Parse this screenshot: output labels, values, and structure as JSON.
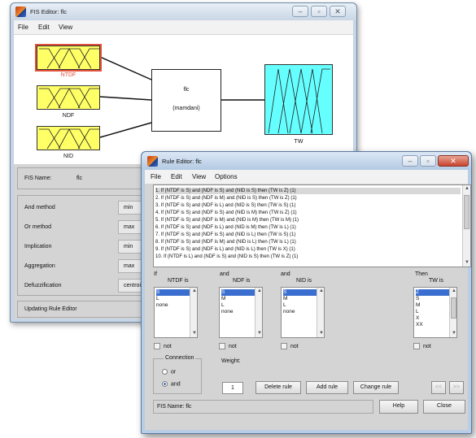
{
  "fis_editor": {
    "title": "FIS Editor: flc",
    "menu": [
      "File",
      "Edit",
      "View"
    ],
    "inputs": [
      "NTDF",
      "NDF",
      "NID"
    ],
    "system_name": "flc",
    "system_type": "(mamdani)",
    "output": "TW",
    "fis_name_label": "FIS Name:",
    "fis_name_value": "flc",
    "methods": [
      {
        "label": "And method",
        "value": "min"
      },
      {
        "label": "Or method",
        "value": "max"
      },
      {
        "label": "Implication",
        "value": "min"
      },
      {
        "label": "Aggregation",
        "value": "max"
      },
      {
        "label": "Defuzzification",
        "value": "centroid"
      }
    ],
    "status": "Updating Rule Editor",
    "colors": {
      "input_box": "#ffff66",
      "output_box": "#66ffff",
      "selected_outline": "#e0503a",
      "selected_label": "#e0503a"
    }
  },
  "rule_editor": {
    "title": "Rule Editor: flc",
    "menu": [
      "File",
      "Edit",
      "View",
      "Options"
    ],
    "rules": [
      "1. If (NTDF is S) and (NDF is S) and (NID is S) then (TW is Z) (1)",
      "2. If (NTDF is S) and (NDF is M) and (NID is S) then (TW is Z) (1)",
      "3. If (NTDF is S) and (NDF is L) and (NID is S) then (TW is S) (1)",
      "4. If (NTDF is S) and (NDF is S) and (NID is M) then (TW is Z) (1)",
      "5. If (NTDF is S) and (NDF is M) and (NID is M) then (TW is M) (1)",
      "6. If (NTDF is S) and (NDF is L) and (NID is M) then (TW is L) (1)",
      "7. If (NTDF is S) and (NDF is S) and (NID is L) then (TW is S) (1)",
      "8. If (NTDF is S) and (NDF is M) and (NID is L) then (TW is L) (1)",
      "9. If (NTDF is S) and (NDF is L) and (NID is L) then (TW is X) (1)",
      "10. If (NTDF is L) and (NDF is S) and (NID is S) then (TW is Z) (1)"
    ],
    "clauses": [
      {
        "prefix": "If",
        "var_label": "NTDF is",
        "options": [
          "S",
          "L",
          "none"
        ]
      },
      {
        "prefix": "and",
        "var_label": "NDF is",
        "options": [
          "S",
          "M",
          "L",
          "none"
        ]
      },
      {
        "prefix": "and",
        "var_label": "NID is",
        "options": [
          "S",
          "M",
          "L",
          "none"
        ]
      },
      {
        "prefix": "Then",
        "var_label": "TW is",
        "options": [
          "Z",
          "S",
          "M",
          "L",
          "X",
          "XX"
        ]
      }
    ],
    "not_label": "not",
    "connection_label": "Connection",
    "or_label": "or",
    "and_label": "and",
    "weight_label": "Weight:",
    "weight_value": "1",
    "buttons": {
      "delete": "Delete rule",
      "add": "Add rule",
      "change": "Change rule",
      "prev": "<<",
      "next": ">>",
      "help": "Help",
      "close": "Close"
    },
    "status": "FIS Name: flc"
  }
}
